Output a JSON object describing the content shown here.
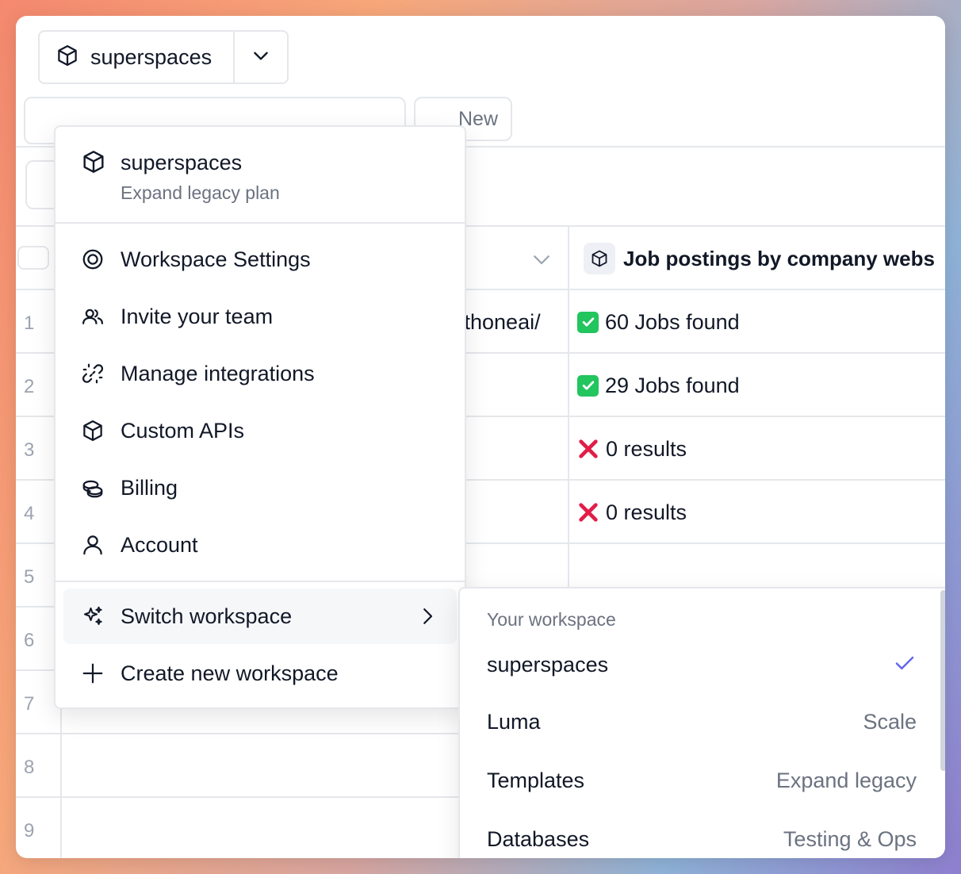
{
  "workspace_button": {
    "name": "superspaces",
    "icon": "cube-icon",
    "dropdown_icon": "chevron-down-icon"
  },
  "tabs": {
    "new_label": "New"
  },
  "table": {
    "column_header": "Job postings by company webs",
    "column_header_icon": "cube-icon",
    "partial_cell_text": "vithoneai/",
    "row_numbers": [
      "1",
      "2",
      "3",
      "4",
      "5",
      "6",
      "7",
      "8",
      "9"
    ],
    "results": [
      {
        "status": "success",
        "text": "60 Jobs found"
      },
      {
        "status": "success",
        "text": "29 Jobs found"
      },
      {
        "status": "fail",
        "text": "0 results"
      },
      {
        "status": "fail",
        "text": "0 results"
      }
    ]
  },
  "menu": {
    "header": {
      "name": "superspaces",
      "plan": "Expand legacy plan",
      "icon": "cube-icon"
    },
    "items": [
      {
        "label": "Workspace Settings",
        "icon": "settings-ring-icon"
      },
      {
        "label": "Invite your team",
        "icon": "users-icon"
      },
      {
        "label": "Manage integrations",
        "icon": "link-broken-icon"
      },
      {
        "label": "Custom APIs",
        "icon": "cube-icon"
      },
      {
        "label": "Billing",
        "icon": "coins-icon"
      },
      {
        "label": "Account",
        "icon": "user-icon"
      }
    ],
    "switch_workspace": {
      "label": "Switch workspace",
      "icon": "sparkles-icon"
    },
    "create_workspace": {
      "label": "Create new workspace",
      "icon": "plus-icon"
    }
  },
  "submenu": {
    "heading": "Your workspace",
    "workspaces": [
      {
        "name": "superspaces",
        "plan": "",
        "selected": true
      },
      {
        "name": "Luma",
        "plan": "Scale",
        "selected": false
      },
      {
        "name": "Templates",
        "plan": "Expand legacy",
        "selected": false
      },
      {
        "name": "Databases",
        "plan": "Testing & Ops",
        "selected": false
      }
    ]
  },
  "colors": {
    "accent_check": "#6366f1",
    "success": "#22c55e",
    "fail": "#e11d48",
    "border": "#e5e7eb"
  }
}
